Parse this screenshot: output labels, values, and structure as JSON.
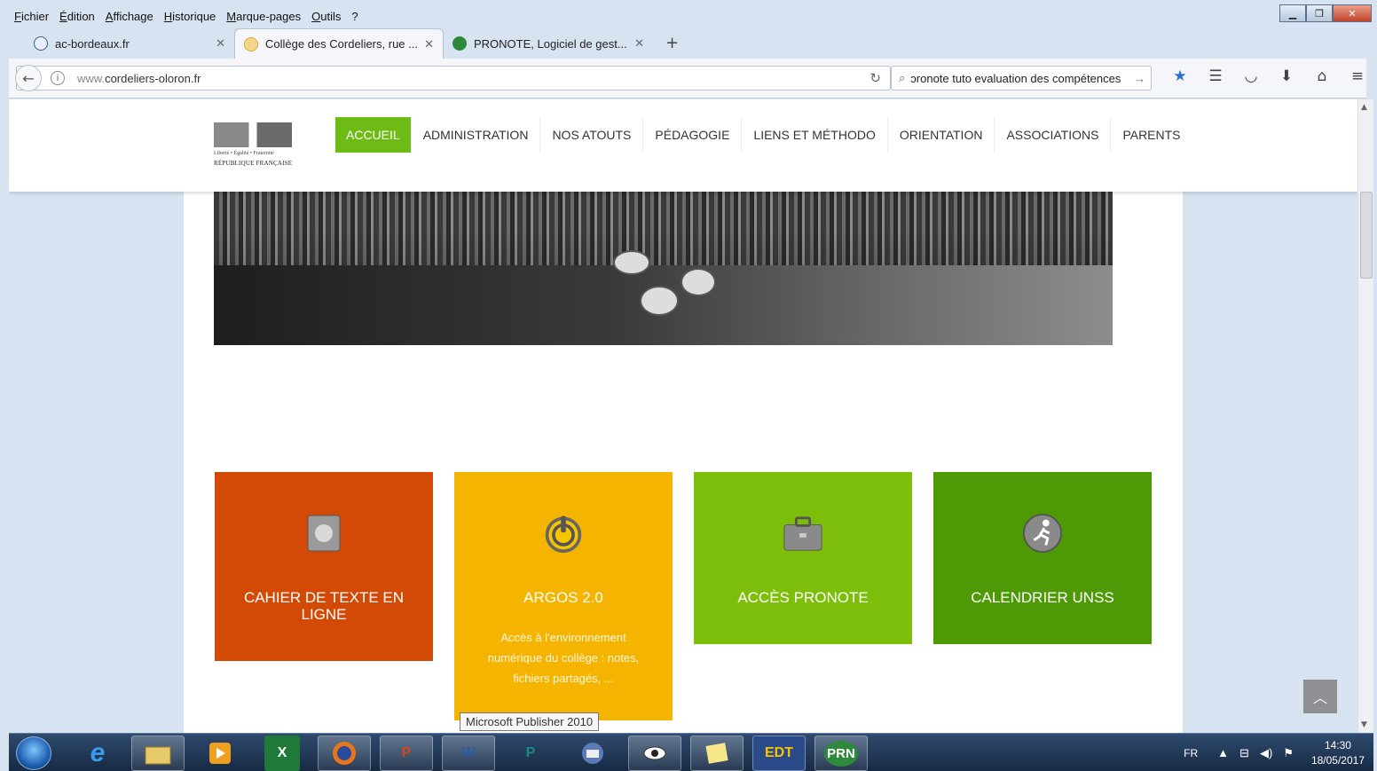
{
  "browser": {
    "menu": [
      "Fichier",
      "Édition",
      "Affichage",
      "Historique",
      "Marque-pages",
      "Outils",
      "?"
    ],
    "tabs": [
      {
        "title": "ac-bordeaux.fr",
        "active": false
      },
      {
        "title": "Collège des Cordeliers, rue ...",
        "active": true
      },
      {
        "title": "PRONOTE, Logiciel de gest...",
        "active": false
      }
    ],
    "url_prefix": "www.",
    "url_domain": "cordeliers-oloron.fr",
    "search_text": "ɔronote tuto evaluation des compétences"
  },
  "site": {
    "logo": {
      "motto": "Liberté • Égalité • Fraternité",
      "name": "RÉPUBLIQUE FRANÇAISE"
    },
    "nav": [
      "ACCUEIL",
      "ADMINISTRATION",
      "NOS ATOUTS",
      "PÉDAGOGIE",
      "LIENS ET MÉTHODO",
      "ORIENTATION",
      "ASSOCIATIONS",
      "PARENTS"
    ],
    "tiles": [
      {
        "title": "CAHIER DE TEXTE EN LIGNE",
        "desc": "",
        "color": "#d24a05",
        "icon": "notebook-icon"
      },
      {
        "title": "ARGOS 2.0",
        "desc": "Accès à l'environnement numérique du collège : notes, fichiers partagés, ...",
        "color": "#f5b400",
        "icon": "power-icon"
      },
      {
        "title": "ACCÈS PRONOTE",
        "desc": "",
        "color": "#7dbe0a",
        "icon": "briefcase-icon"
      },
      {
        "title": "CALENDRIER UNSS",
        "desc": "",
        "color": "#4e9a06",
        "icon": "runner-icon"
      }
    ],
    "tooltip": "Microsoft Publisher 2010"
  },
  "taskbar": {
    "apps": [
      "e",
      "",
      "",
      "X",
      "",
      "P",
      "W",
      "P",
      "",
      "",
      "",
      "EDT",
      "PRN"
    ],
    "lang": "FR",
    "time": "14:30",
    "date": "18/05/2017"
  }
}
